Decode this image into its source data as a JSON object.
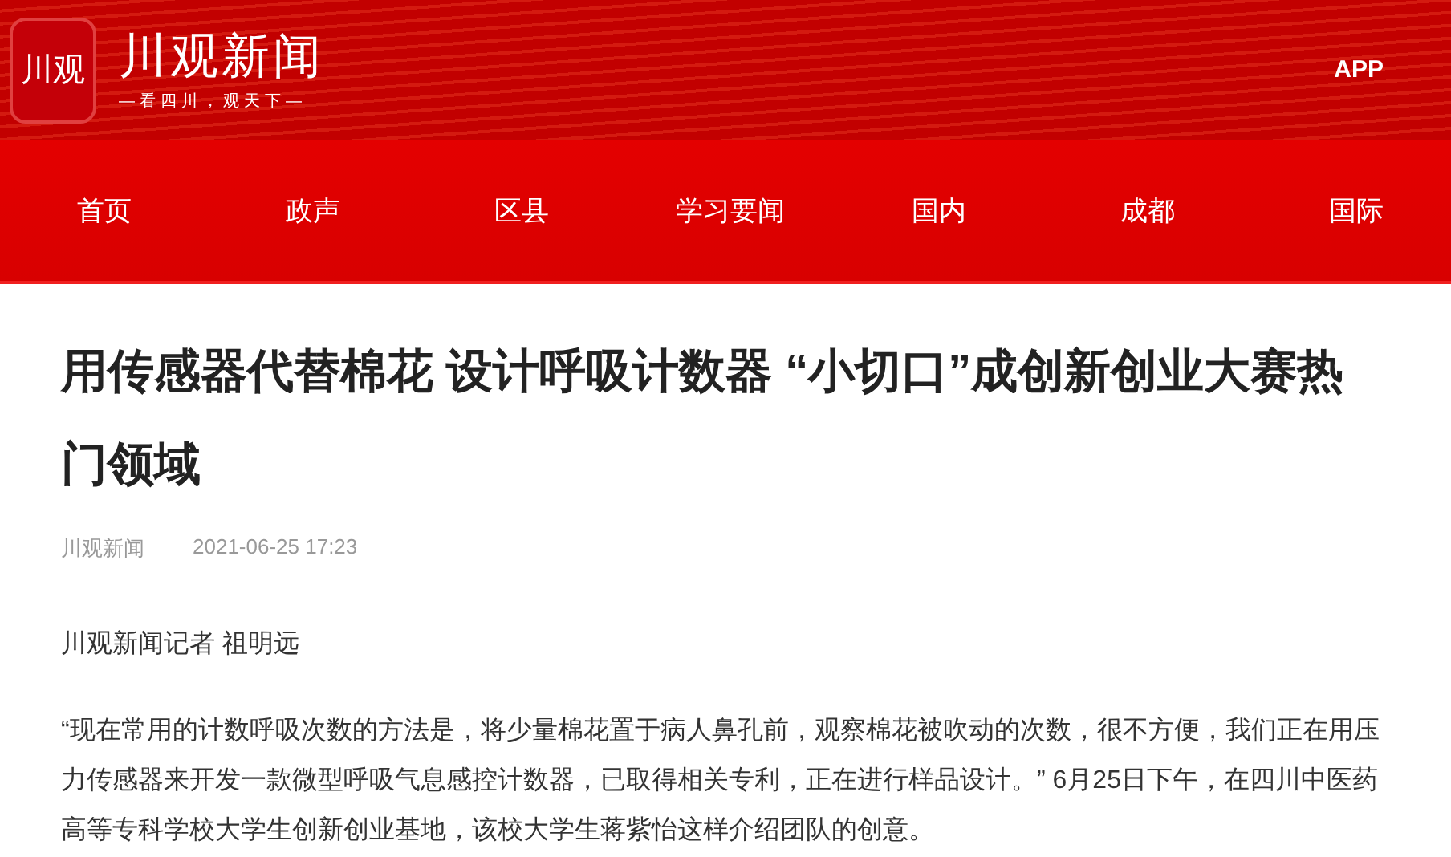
{
  "header": {
    "logo_mark": "川观",
    "logo_title": "川观新闻",
    "logo_slogan": "—看四川，观天下—",
    "app_link": "APP"
  },
  "nav": [
    "首页",
    "政声",
    "区县",
    "学习要闻",
    "国内",
    "成都",
    "国际"
  ],
  "article": {
    "title": "用传感器代替棉花 设计呼吸计数器 “小切口”成创新创业大赛热门领域",
    "source": "川观新闻",
    "date": "2021-06-25 17:23",
    "byline": "川观新闻记者 祖明远",
    "paragraphs": [
      "“现在常用的计数呼吸次数的方法是，将少量棉花置于病人鼻孔前，观察棉花被吹动的次数，很不方便，我们正在用压力传感器来开发一款微型呼吸气息感控计数器，已取得相关专利，正在进行样品设计。” 6月25日下午，在四川中医药高等专科学校大学生创新创业基地，该校大学生蒋紫怡这样介绍团队的创意。"
    ]
  }
}
